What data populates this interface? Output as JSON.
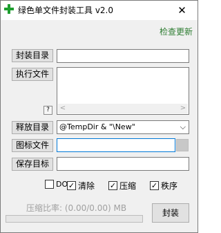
{
  "window": {
    "title": "绿色单文件封装工具 v2.0",
    "close_glyph": "✕",
    "icon": "green-plus-icon"
  },
  "update_link": "检查更新",
  "rows": {
    "package_dir": {
      "button": "封装目录",
      "value": ""
    },
    "exec_file": {
      "button": "执行文件",
      "help": "?",
      "scroll_left": "<",
      "scroll_right": ">"
    },
    "extract_dir": {
      "button": "释放目录",
      "value": "@TempDir & \"\\New\"",
      "chevron": "⌵"
    },
    "icon_file": {
      "button": "图标文件",
      "value": ""
    },
    "save_target": {
      "button": "保存目标",
      "value": ""
    }
  },
  "options": [
    {
      "label": "DOS",
      "checked": false
    },
    {
      "label": "清除",
      "checked": true
    },
    {
      "label": "压缩",
      "checked": true
    },
    {
      "label": "秩序",
      "checked": true
    }
  ],
  "checkmark": "✓",
  "compression_ratio": "压缩比率: (0.00/0.00) MB",
  "progress": 0,
  "pack_button": "封装",
  "colors": {
    "update_link": "#2e7d32",
    "focus_border": "#0078d7"
  }
}
